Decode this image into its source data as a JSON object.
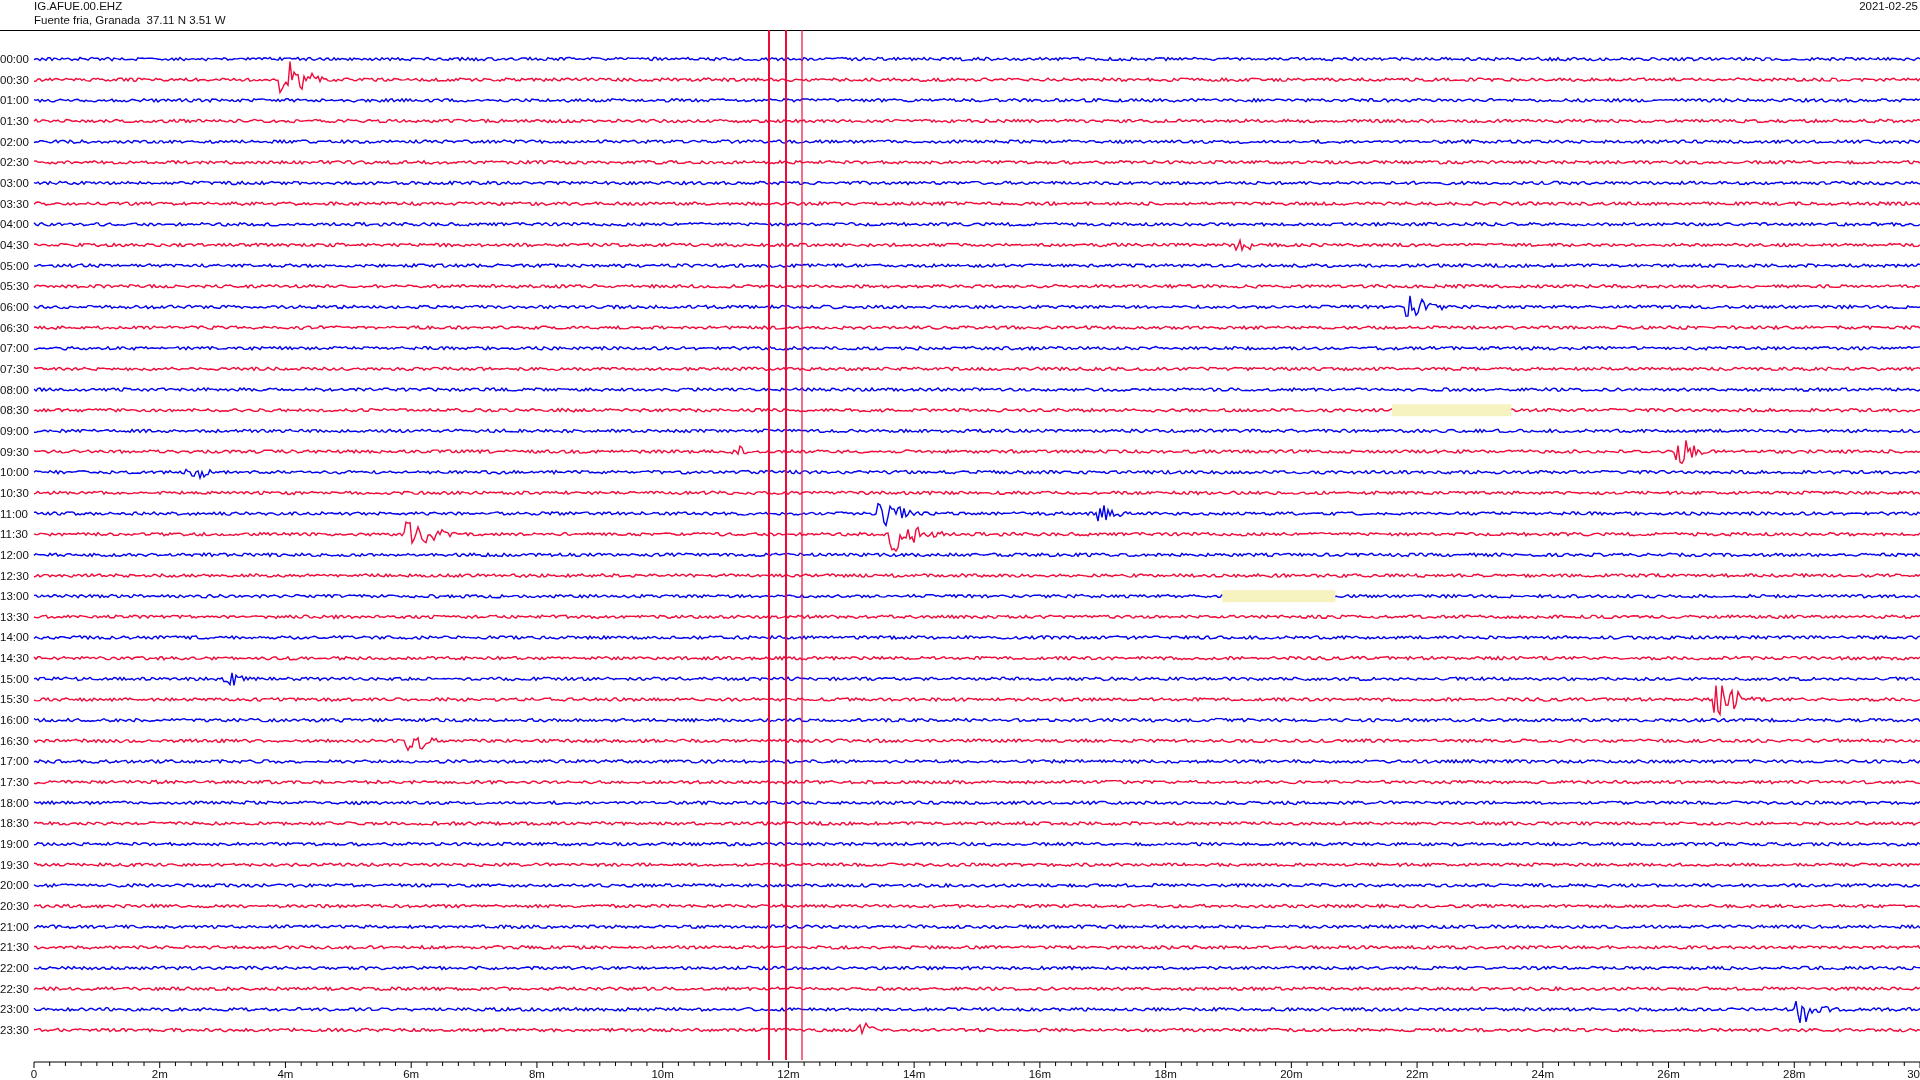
{
  "header": {
    "station": "IG.AFUE.00.EHZ",
    "location": "Fuente fria, Granada  37.11 N 3.51 W",
    "date": "2021-02-25"
  },
  "traces": [
    {
      "label": "00:00",
      "color": "#0000ee"
    },
    {
      "label": "00:30",
      "color": "#f00a3a"
    },
    {
      "label": "01:00",
      "color": "#0000ee"
    },
    {
      "label": "01:30",
      "color": "#f00a3a"
    },
    {
      "label": "02:00",
      "color": "#0000ee"
    },
    {
      "label": "02:30",
      "color": "#f00a3a"
    },
    {
      "label": "03:00",
      "color": "#0000ee"
    },
    {
      "label": "03:30",
      "color": "#f00a3a"
    },
    {
      "label": "04:00",
      "color": "#0000ee"
    },
    {
      "label": "04:30",
      "color": "#f00a3a"
    },
    {
      "label": "05:00",
      "color": "#0000ee"
    },
    {
      "label": "05:30",
      "color": "#f00a3a"
    },
    {
      "label": "06:00",
      "color": "#0000ee"
    },
    {
      "label": "06:30",
      "color": "#f00a3a"
    },
    {
      "label": "07:00",
      "color": "#0000ee"
    },
    {
      "label": "07:30",
      "color": "#f00a3a"
    },
    {
      "label": "08:00",
      "color": "#0000ee"
    },
    {
      "label": "08:30",
      "color": "#f00a3a"
    },
    {
      "label": "09:00",
      "color": "#0000ee"
    },
    {
      "label": "09:30",
      "color": "#f00a3a"
    },
    {
      "label": "10:00",
      "color": "#0000ee"
    },
    {
      "label": "10:30",
      "color": "#f00a3a"
    },
    {
      "label": "11:00",
      "color": "#0000ee"
    },
    {
      "label": "11:30",
      "color": "#f00a3a"
    },
    {
      "label": "12:00",
      "color": "#0000ee"
    },
    {
      "label": "12:30",
      "color": "#f00a3a"
    },
    {
      "label": "13:00",
      "color": "#0000ee"
    },
    {
      "label": "13:30",
      "color": "#f00a3a"
    },
    {
      "label": "14:00",
      "color": "#0000ee"
    },
    {
      "label": "14:30",
      "color": "#f00a3a"
    },
    {
      "label": "15:00",
      "color": "#0000ee"
    },
    {
      "label": "15:30",
      "color": "#f00a3a"
    },
    {
      "label": "16:00",
      "color": "#0000ee"
    },
    {
      "label": "16:30",
      "color": "#f00a3a"
    },
    {
      "label": "17:00",
      "color": "#0000ee"
    },
    {
      "label": "17:30",
      "color": "#f00a3a"
    },
    {
      "label": "18:00",
      "color": "#0000ee"
    },
    {
      "label": "18:30",
      "color": "#f00a3a"
    },
    {
      "label": "19:00",
      "color": "#0000ee"
    },
    {
      "label": "19:30",
      "color": "#f00a3a"
    },
    {
      "label": "20:00",
      "color": "#0000ee"
    },
    {
      "label": "20:30",
      "color": "#f00a3a"
    },
    {
      "label": "21:00",
      "color": "#0000ee"
    },
    {
      "label": "21:30",
      "color": "#f00a3a"
    },
    {
      "label": "22:00",
      "color": "#0000ee"
    },
    {
      "label": "22:30",
      "color": "#f00a3a"
    },
    {
      "label": "23:00",
      "color": "#0000ee"
    },
    {
      "label": "23:30",
      "color": "#f00a3a"
    }
  ],
  "x_axis": {
    "labels": [
      "0",
      "2m",
      "4m",
      "6m",
      "8m",
      "10m",
      "12m",
      "14m",
      "16m",
      "18m",
      "20m",
      "22m",
      "24m",
      "26m",
      "28m",
      "30"
    ]
  }
}
